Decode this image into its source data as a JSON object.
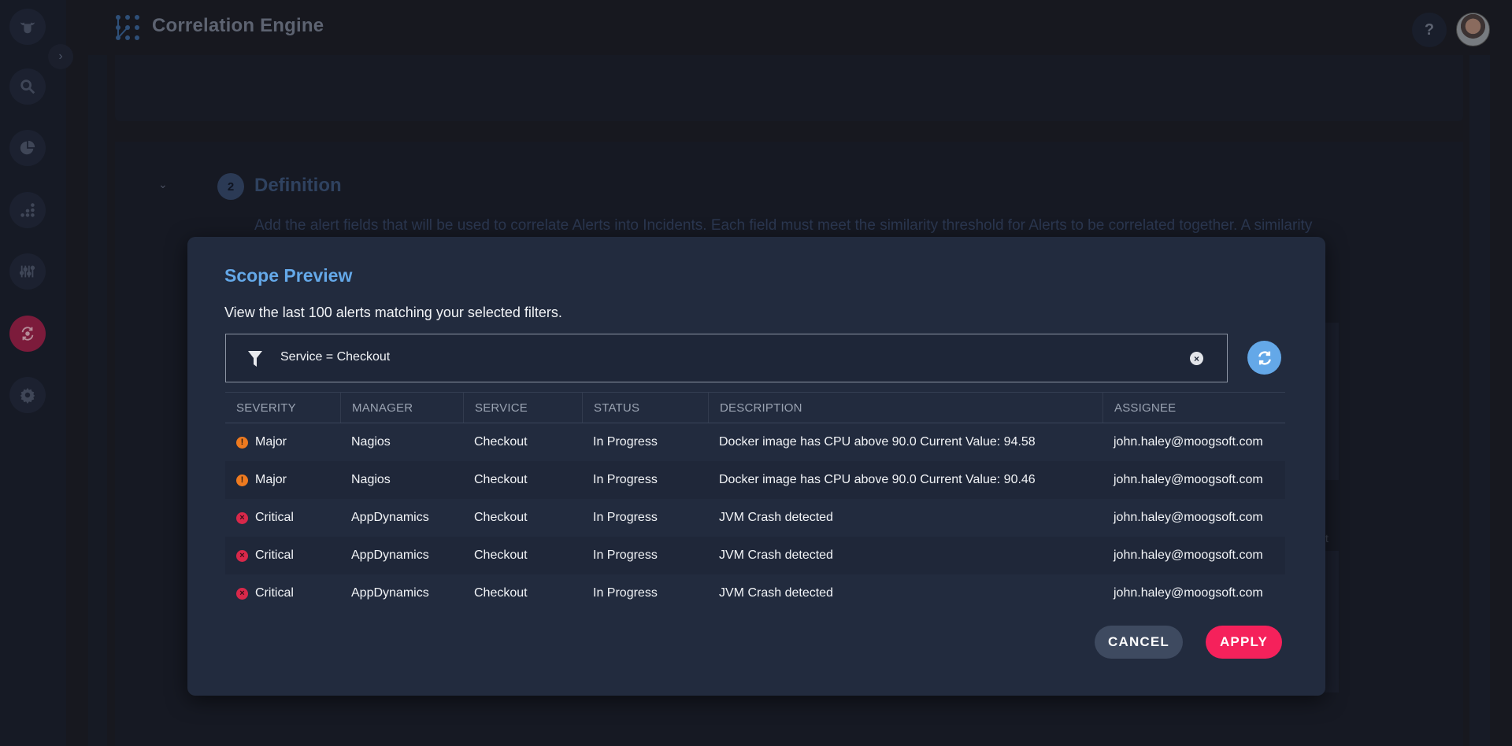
{
  "app": {
    "title": "Correlation Engine",
    "help_label": "?"
  },
  "sidebar": {
    "items": [
      {
        "name": "logo",
        "icon": "cow-icon"
      },
      {
        "name": "search",
        "icon": "search-icon"
      },
      {
        "name": "dashboards",
        "icon": "pie-chart-icon"
      },
      {
        "name": "insights",
        "icon": "bar-dots-icon"
      },
      {
        "name": "tuning",
        "icon": "sliders-icon"
      },
      {
        "name": "correlation",
        "icon": "sync-icon",
        "active": true
      },
      {
        "name": "settings",
        "icon": "gear-icon"
      }
    ],
    "expand_label": "›"
  },
  "background": {
    "section_number": "2",
    "section_title": "Definition",
    "section_description": "Add the alert fields that will be used to correlate Alerts into Incidents. Each field must meet the similarity threshold for Alerts to be correlated together. A similarity",
    "fragment": "t"
  },
  "modal": {
    "title": "Scope Preview",
    "subtitle": "View the last 100 alerts matching your selected filters.",
    "filter": {
      "text": "Service = Checkout",
      "clear_label": "×"
    },
    "table": {
      "columns": [
        "SEVERITY",
        "MANAGER",
        "SERVICE",
        "STATUS",
        "DESCRIPTION",
        "ASSIGNEE"
      ],
      "rows": [
        {
          "severity": "Major",
          "manager": "Nagios",
          "service": "Checkout",
          "status": "In Progress",
          "description": "Docker image has CPU above 90.0 Current Value: 94.58",
          "assignee": "john.haley@moogsoft.com"
        },
        {
          "severity": "Major",
          "manager": "Nagios",
          "service": "Checkout",
          "status": "In Progress",
          "description": "Docker image has CPU above 90.0 Current Value: 90.46",
          "assignee": "john.haley@moogsoft.com"
        },
        {
          "severity": "Critical",
          "manager": "AppDynamics",
          "service": "Checkout",
          "status": "In Progress",
          "description": "JVM Crash detected",
          "assignee": "john.haley@moogsoft.com"
        },
        {
          "severity": "Critical",
          "manager": "AppDynamics",
          "service": "Checkout",
          "status": "In Progress",
          "description": "JVM Crash detected",
          "assignee": "john.haley@moogsoft.com"
        },
        {
          "severity": "Critical",
          "manager": "AppDynamics",
          "service": "Checkout",
          "status": "In Progress",
          "description": "JVM Crash detected",
          "assignee": "john.haley@moogsoft.com"
        }
      ]
    },
    "severity_glyphs": {
      "Major": "!",
      "Critical": "×"
    },
    "cancel_label": "CANCEL",
    "apply_label": "APPLY"
  },
  "colors": {
    "accent_blue": "#64a8e8",
    "apply_pink": "#f5215b",
    "major_orange": "#ee7a1f",
    "critical_red": "#d8284a",
    "modal_bg": "#222b3e"
  }
}
